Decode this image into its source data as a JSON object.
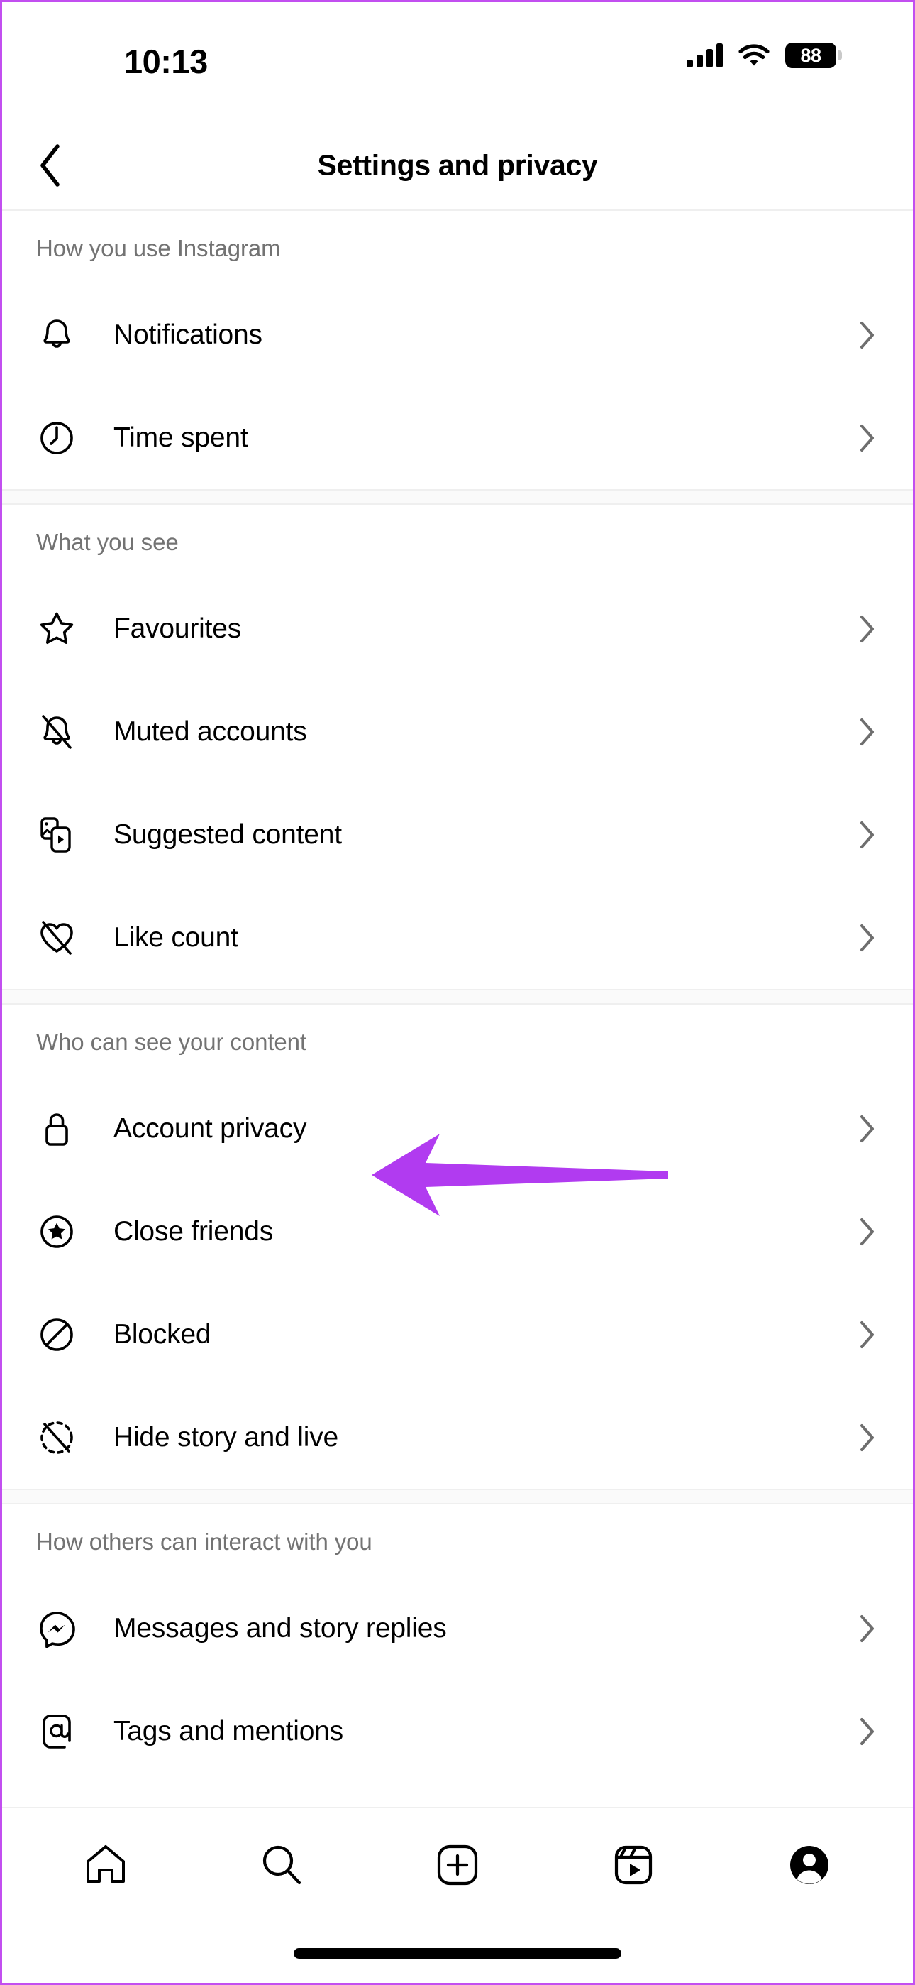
{
  "status_bar": {
    "time": "10:13",
    "battery_percent": "88",
    "signal_icon": "cellular-signal-icon",
    "wifi_icon": "wifi-icon",
    "battery_icon": "battery-icon"
  },
  "header": {
    "title": "Settings and privacy",
    "back_icon": "chevron-left-icon"
  },
  "sections": [
    {
      "title": "How you use Instagram",
      "items": [
        {
          "label": "Notifications",
          "icon": "bell-icon"
        },
        {
          "label": "Time spent",
          "icon": "clock-icon"
        }
      ]
    },
    {
      "title": "What you see",
      "items": [
        {
          "label": "Favourites",
          "icon": "star-icon"
        },
        {
          "label": "Muted accounts",
          "icon": "bell-slash-icon"
        },
        {
          "label": "Suggested content",
          "icon": "suggested-content-icon"
        },
        {
          "label": "Like count",
          "icon": "heart-slash-icon"
        }
      ]
    },
    {
      "title": "Who can see your content",
      "items": [
        {
          "label": "Account privacy",
          "icon": "lock-icon",
          "highlighted": true
        },
        {
          "label": "Close friends",
          "icon": "close-friends-star-icon"
        },
        {
          "label": "Blocked",
          "icon": "block-icon"
        },
        {
          "label": "Hide story and live",
          "icon": "hide-story-icon"
        }
      ]
    },
    {
      "title": "How others can interact with you",
      "items": [
        {
          "label": "Messages and story replies",
          "icon": "messenger-icon"
        },
        {
          "label": "Tags and mentions",
          "icon": "at-mention-icon"
        }
      ]
    }
  ],
  "annotation": {
    "arrow_color": "#b13bf0",
    "points_at": "Account privacy"
  },
  "tab_bar": {
    "items": [
      {
        "icon": "home-icon",
        "name": "tab-home"
      },
      {
        "icon": "search-icon",
        "name": "tab-search"
      },
      {
        "icon": "create-plus-icon",
        "name": "tab-create"
      },
      {
        "icon": "reels-icon",
        "name": "tab-reels"
      },
      {
        "icon": "profile-avatar-icon",
        "name": "tab-profile"
      }
    ]
  },
  "colors": {
    "accent_arrow": "#b13bf0",
    "section_header_text": "#737373",
    "chevron": "#6e6e6e",
    "divider": "#efefef",
    "section_gap_bg": "#fafafa"
  }
}
